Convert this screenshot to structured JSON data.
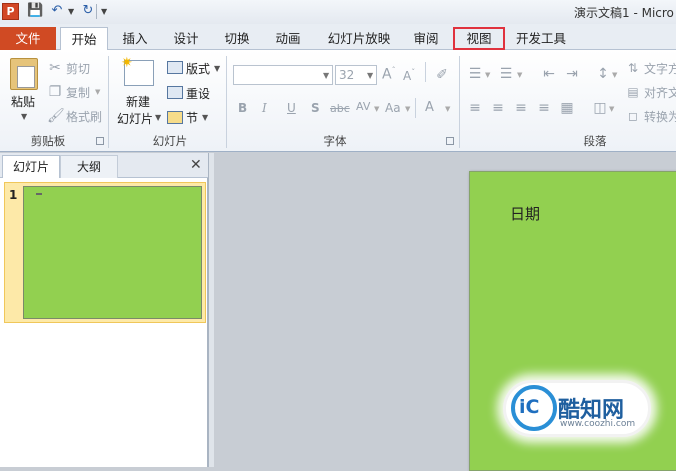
{
  "app": {
    "logo_letter": "P",
    "title": "演示文稿1 - Micro"
  },
  "qat": {
    "save_icon": "save-icon",
    "undo_icon": "undo-icon",
    "redo_icon": "redo-icon"
  },
  "tabs": {
    "file": "文件",
    "items": [
      "开始",
      "插入",
      "设计",
      "切换",
      "动画",
      "幻灯片放映",
      "审阅",
      "视图",
      "开发工具"
    ],
    "active": "开始",
    "highlighted": "视图",
    "highlight_color": "#e0323e"
  },
  "ribbon": {
    "clipboard": {
      "paste": "粘贴",
      "cut": "剪切",
      "copy": "复制",
      "format_painter": "格式刷",
      "group_label": "剪贴板"
    },
    "slides": {
      "new_slide_line1": "新建",
      "new_slide_line2": "幻灯片",
      "layout": "版式",
      "reset": "重设",
      "section": "节",
      "group_label": "幻灯片"
    },
    "font": {
      "size": "32",
      "bold": "B",
      "italic": "I",
      "underline": "U",
      "shadow": "S",
      "strike": "abc",
      "spacing": "AV",
      "case": "Aa",
      "color": "A",
      "group_label": "字体"
    },
    "paragraph": {
      "text_direction": "文字方",
      "align_text": "对齐文",
      "convert": "转换为",
      "group_label": "段落"
    }
  },
  "left_pane": {
    "tab_slides": "幻灯片",
    "tab_outline": "大纲",
    "close": "✕",
    "slide_number": "1"
  },
  "slide": {
    "text": "日期",
    "background": "#92d050"
  },
  "watermark": {
    "logo_text": "酷知网",
    "url": "www.coozhi.com"
  }
}
